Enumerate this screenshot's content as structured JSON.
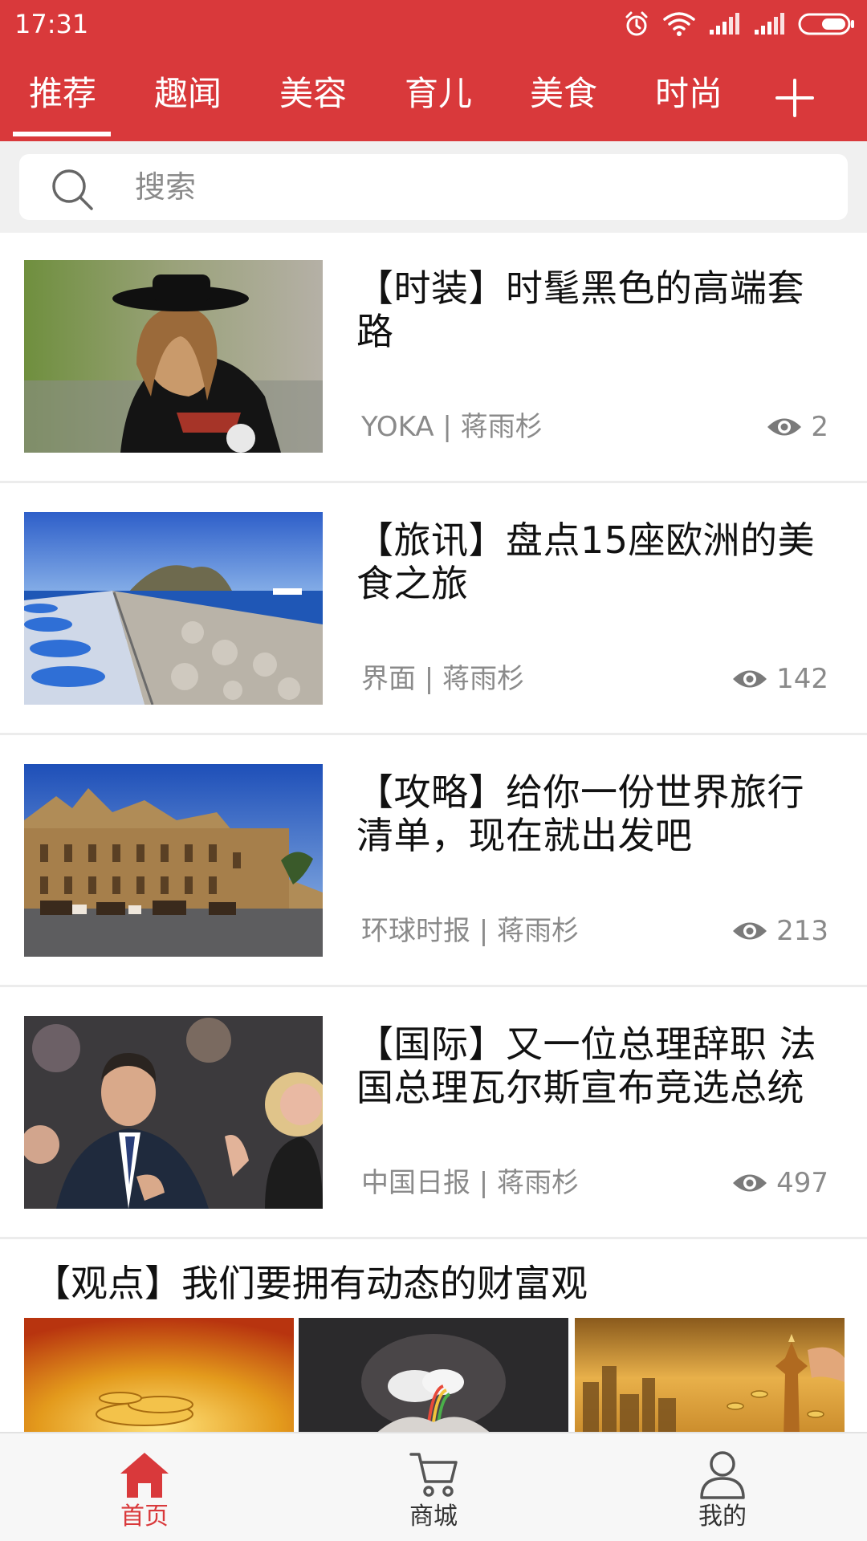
{
  "status_bar": {
    "time": "17:31",
    "icons": [
      "alarm-icon",
      "wifi-icon",
      "signal-icon",
      "signal-icon",
      "battery-icon"
    ]
  },
  "tabs": {
    "items": [
      {
        "label": "推荐"
      },
      {
        "label": "趣闻"
      },
      {
        "label": "美容"
      },
      {
        "label": "育儿"
      },
      {
        "label": "美食"
      },
      {
        "label": "时尚"
      }
    ],
    "active": "推荐",
    "add_icon": "plus-icon"
  },
  "search": {
    "placeholder": "搜索",
    "icon": "search-icon"
  },
  "feed": {
    "items": [
      {
        "title": "【时装】时髦黑色的高端套路",
        "source": "YOKA",
        "author": "蒋雨杉",
        "meta": "YOKA | 蒋雨杉",
        "views": "2",
        "thumb": "fashion-photo"
      },
      {
        "title": "【旅讯】盘点15座欧洲的美食之旅",
        "source": "界面",
        "author": "蒋雨杉",
        "meta": "界面 | 蒋雨杉",
        "views": "142",
        "thumb": "seaside-photo"
      },
      {
        "title": "【攻略】给你一份世界旅行清单，现在就出发吧",
        "source": "环球时报",
        "author": "蒋雨杉",
        "meta": "环球时报 | 蒋雨杉",
        "views": "213",
        "thumb": "cathedral-photo"
      },
      {
        "title": "【国际】又一位总理辞职 法国总理瓦尔斯宣布竞选总统",
        "source": "中国日报",
        "author": "蒋雨杉",
        "meta": "中国日报 | 蒋雨杉",
        "views": "497",
        "thumb": "politician-photo"
      }
    ],
    "gallery": {
      "title": "【观点】我们要拥有动态的财富观",
      "thumbs": [
        "gold-coins-photo",
        "rainbow-hands-photo",
        "golden-city-photo"
      ]
    }
  },
  "bottom_nav": {
    "items": [
      {
        "label": "首页",
        "icon": "home-icon"
      },
      {
        "label": "商城",
        "icon": "cart-icon"
      },
      {
        "label": "我的",
        "icon": "user-icon"
      }
    ],
    "active": "首页"
  },
  "colors": {
    "brand_red": "#d9393b",
    "text_primary": "#111111",
    "text_secondary": "#8a8a8a",
    "background": "#f0f0f0"
  }
}
